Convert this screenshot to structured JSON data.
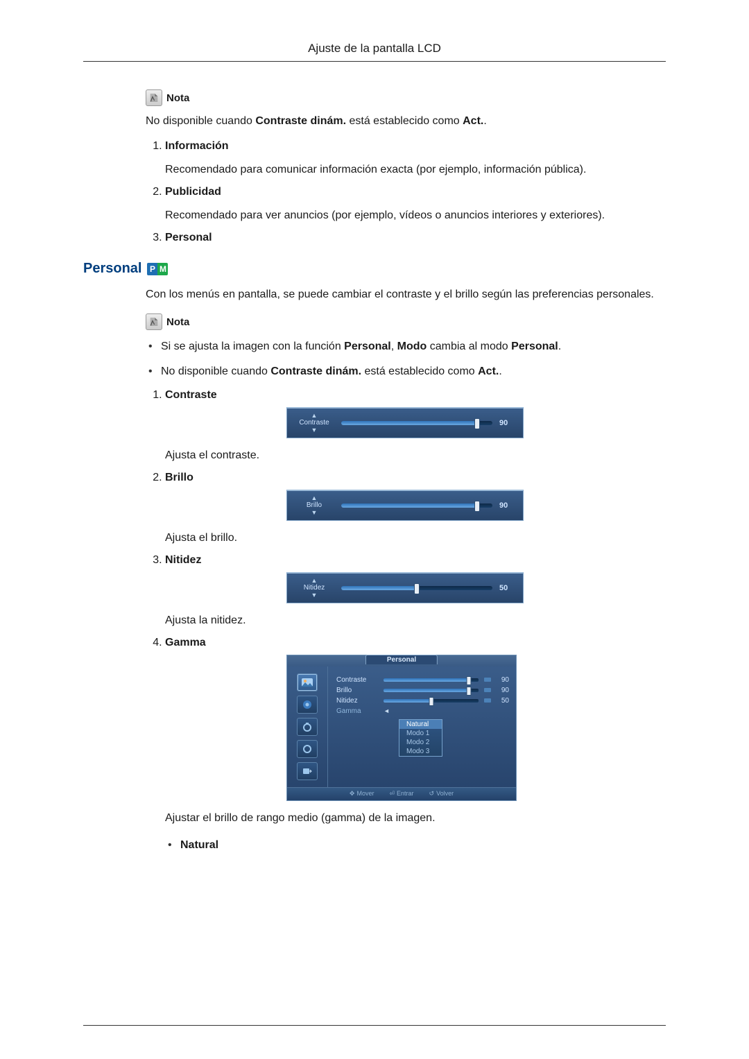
{
  "header": {
    "title": "Ajuste de la pantalla LCD"
  },
  "note_label": "Nota",
  "intro_note_parts": {
    "a": "No disponible cuando ",
    "b": "Contraste dinám.",
    "c": " está establecido como ",
    "d": "Act.",
    "e": "."
  },
  "top_list": [
    {
      "title": "Información",
      "body": "Recomendado para comunicar información exacta (por ejemplo, información pública)."
    },
    {
      "title": "Publicidad",
      "body": "Recomendado para ver anuncios (por ejemplo, vídeos o anuncios interiores y exteriores)."
    },
    {
      "title": "Personal",
      "body": ""
    }
  ],
  "section": {
    "title": "Personal",
    "badge_p": "P",
    "badge_m": "M",
    "intro": "Con los menús en pantalla, se puede cambiar el contraste y el brillo según las preferencias personales.",
    "bullet1": {
      "a": "Si se ajusta la imagen con la función ",
      "b": "Personal",
      "c": ", ",
      "d": "Modo",
      "e": " cambia al modo ",
      "f": "Personal",
      "g": "."
    },
    "bullet2": {
      "a": "No disponible cuando ",
      "b": "Contraste dinám.",
      "c": " está establecido como ",
      "d": "Act.",
      "e": "."
    },
    "items": [
      {
        "title": "Contraste",
        "osd_label": "Contraste",
        "value": "90",
        "pct": 90,
        "caption": "Ajusta el contraste."
      },
      {
        "title": "Brillo",
        "osd_label": "Brillo",
        "value": "90",
        "pct": 90,
        "caption": "Ajusta el brillo."
      },
      {
        "title": "Nitidez",
        "osd_label": "Nitidez",
        "value": "50",
        "pct": 50,
        "caption": "Ajusta la nitidez."
      },
      {
        "title": "Gamma",
        "caption": "Ajustar el brillo de rango medio (gamma) de la imagen."
      }
    ],
    "gamma_menu": {
      "tab": "Personal",
      "rows": {
        "contraste": {
          "label": "Contraste",
          "value": "90",
          "pct": 90
        },
        "brillo": {
          "label": "Brillo",
          "value": "90",
          "pct": 90
        },
        "nitidez": {
          "label": "Nitidez",
          "value": "50",
          "pct": 50
        },
        "gamma": {
          "label": "Gamma"
        }
      },
      "options": [
        "Natural",
        "Modo 1",
        "Modo 2",
        "Modo 3"
      ],
      "footer": {
        "move": "Mover",
        "enter": "Entrar",
        "return": "Volver"
      }
    },
    "gamma_sub": {
      "natural": "Natural"
    }
  }
}
